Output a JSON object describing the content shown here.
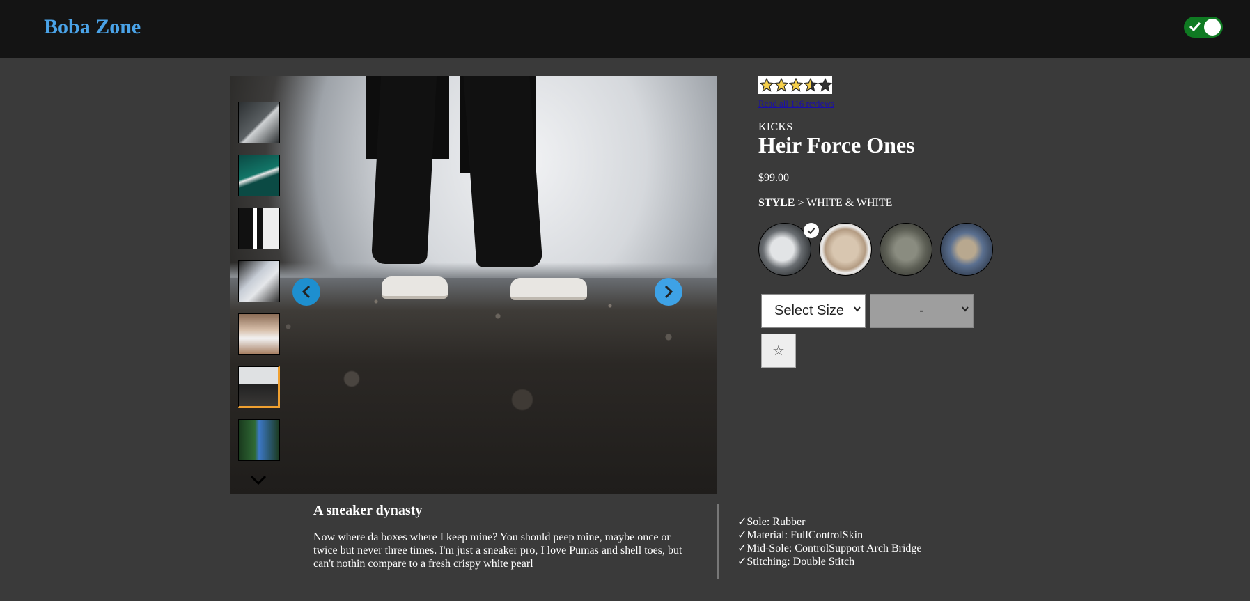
{
  "header": {
    "brand": "Boba Zone"
  },
  "theme_toggle": {
    "on": true
  },
  "gallery": {
    "thumbnail_count": 7,
    "selected_thumbnail": 6
  },
  "product": {
    "rating": 3.5,
    "reviews_link": "Read all 116 reviews",
    "category": "KICKS",
    "name": "Heir Force Ones",
    "price": "$99.00",
    "style_label": "STYLE",
    "style_sep": " > ",
    "style_value": "WHITE & WHITE",
    "size_select": "Select Size",
    "qty_select": "-",
    "favorite_glyph": "☆"
  },
  "description": {
    "heading": "A sneaker dynasty",
    "body": "Now where da boxes where I keep mine? You should peep mine, maybe once or twice but never three times. I'm just a sneaker pro, I love Pumas and shell toes, but can't nothin compare to a fresh crispy white pearl"
  },
  "features": [
    "✓Sole: Rubber",
    "✓Material: FullControlSkin",
    "✓Mid-Sole: ControlSupport Arch Bridge",
    "✓Stitching: Double Stitch"
  ],
  "colors": {
    "brand": "#4aa3e8",
    "toggle": "#0f7a22",
    "accent": "#f0a030",
    "nav": "#3ea2e6"
  }
}
